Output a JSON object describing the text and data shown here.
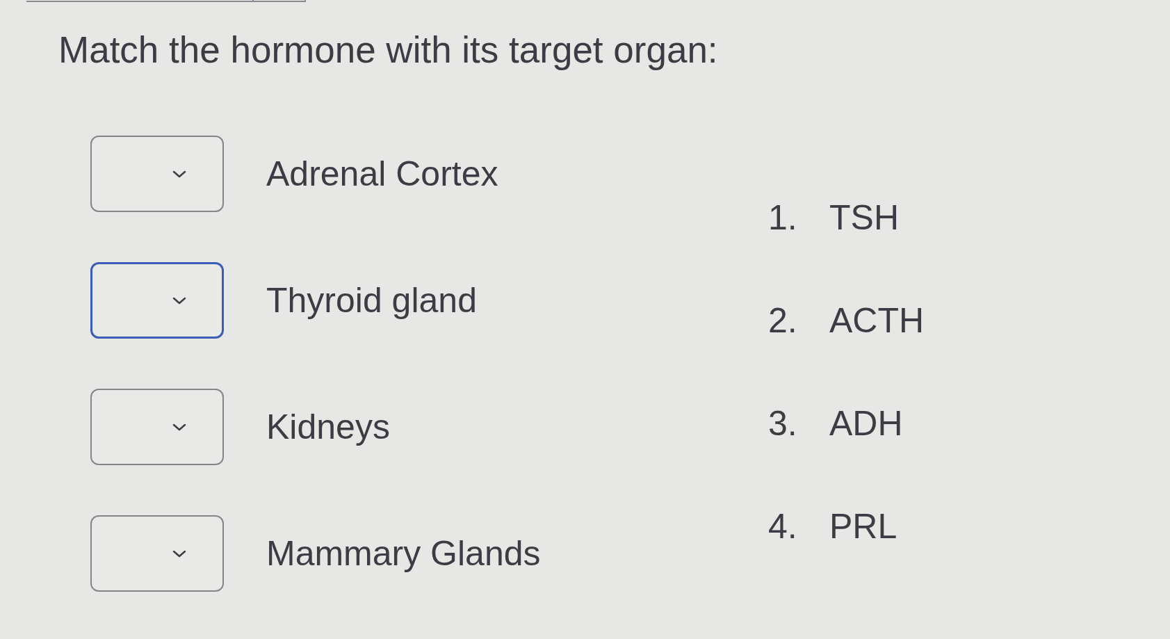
{
  "question": {
    "prompt": "Match the hormone with its target organ:"
  },
  "matches": [
    {
      "label": "Adrenal Cortex",
      "focused": false
    },
    {
      "label": "Thyroid gland",
      "focused": true
    },
    {
      "label": "Kidneys",
      "focused": false
    },
    {
      "label": "Mammary Glands",
      "focused": false
    }
  ],
  "options": [
    {
      "number": "1.",
      "label": "TSH"
    },
    {
      "number": "2.",
      "label": "ACTH"
    },
    {
      "number": "3.",
      "label": "ADH"
    },
    {
      "number": "4.",
      "label": "PRL"
    }
  ]
}
